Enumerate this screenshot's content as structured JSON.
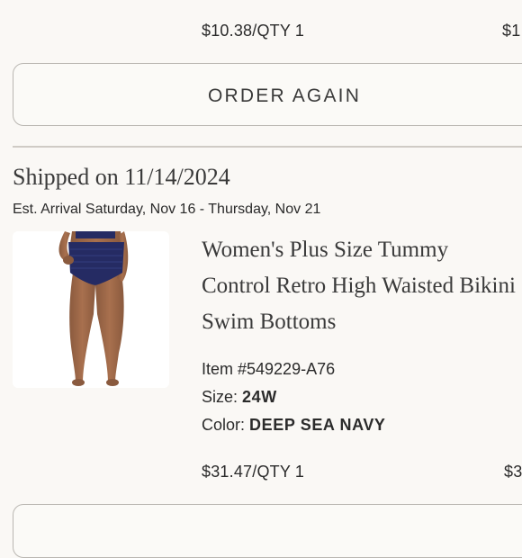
{
  "previous_item": {
    "price_qty": "$10.38/QTY 1",
    "total_partial": "$1"
  },
  "order_again": {
    "label": "ORDER AGAIN"
  },
  "shipment": {
    "title": "Shipped on 11/14/2024",
    "arrival": "Est. Arrival Saturday, Nov 16 - Thursday, Nov 21"
  },
  "product": {
    "image_icon": "swimwear-product-photo",
    "name": "Women's Plus Size Tummy Control Retro High Waisted Bikini Swim Bottoms",
    "item_number": "Item #549229-A76",
    "size_label": "Size:",
    "size_value": "24W",
    "color_label": "Color:",
    "color_value": "DEEP SEA NAVY",
    "price_qty": "$31.47/QTY 1",
    "total_partial": "$3"
  },
  "colors": {
    "background": "#faf8f5",
    "border": "#b9b6b1",
    "text": "#2b2b2b",
    "swim_navy": "#252b63"
  }
}
